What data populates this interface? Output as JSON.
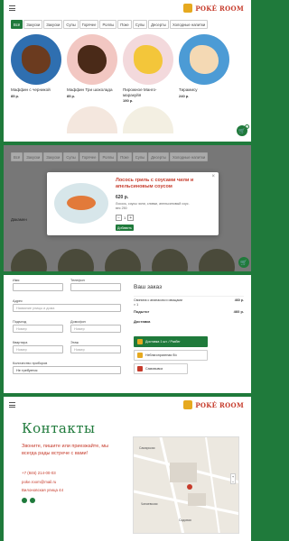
{
  "brand": {
    "name": "POKÉ ROOM",
    "accent": "#1f7a3b",
    "red": "#c63b2b",
    "gold": "#e6a91f"
  },
  "tabs": [
    "Всё",
    "Закуски",
    "Закуски",
    "Супы",
    "Горячее",
    "Роллы",
    "Поке",
    "Супы",
    "Десерты",
    "Холодные напитки"
  ],
  "products": [
    {
      "name": "Маффин с черникой",
      "price": "85 р.",
      "plate": "#2f6fb0",
      "food": "#6b3b1f"
    },
    {
      "name": "Маффин Три шоколада",
      "price": "85 р.",
      "plate": "#f2c7c2",
      "food": "#4a2a18"
    },
    {
      "name": "Пирожное Манго-маракуйя",
      "price": "190 р.",
      "plate": "#f3d9dc",
      "food": "#f3c63a"
    },
    {
      "name": "Тирамису",
      "price": "240 р.",
      "plate": "#4c9bd5",
      "food": "#f4d9b4"
    }
  ],
  "cart": {
    "count": "1"
  },
  "modal": {
    "dim_item_1": "Дакамен",
    "dim_item_2": "Севиче",
    "title": "Лосось гриль с соусами чили и апельсиновым соусом",
    "price": "620 р.",
    "description": "Лосось, соусы чили, сливки, апельсиновый соус.",
    "weight": "вес 250",
    "qty": "1",
    "add_label": "Добавить"
  },
  "form": {
    "name_label": "Имя",
    "phone_label": "Телефон",
    "address_label": "Адрес",
    "address_placeholder": "Название улицы и дома",
    "entrance_label": "Подъезд",
    "entrance_placeholder": "Номер",
    "intercom_label": "Домофон",
    "intercom_placeholder": "Номер",
    "flat_label": "Квартира",
    "flat_placeholder": "Номер",
    "floor_label": "Этаж",
    "floor_placeholder": "Номер",
    "cutlery_label": "Количество приборов",
    "cutlery_value": "Не требуется"
  },
  "order": {
    "title": "Ваш заказ",
    "item_name": "Свинина с ананасом и овощами",
    "item_qty": "× 1",
    "item_price": "460 р.",
    "subtotal_label": "Подытог",
    "subtotal_value": "460 р.",
    "delivery_label": "Доставка",
    "options": [
      "Доставка 1 шт. / Разбег",
      "Неблагоприятная б/с",
      "Самовывоз"
    ]
  },
  "contacts": {
    "title": "Контакты",
    "tagline": "Звоните, пишите или приезжайте, мы всегда рады встрече с вами!",
    "phone": "+7 (846) 214-00-03",
    "email": "poke.room@mail.ru",
    "address": "Вилоновская улица 44",
    "map_labels": [
      "Самарская",
      "Садовая",
      "Чапаевская"
    ]
  }
}
